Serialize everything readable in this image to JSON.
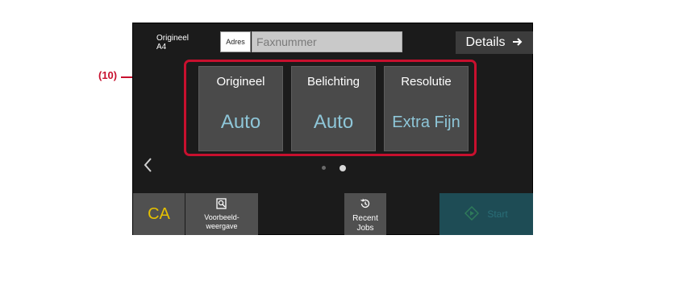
{
  "callout": {
    "label": "(10)",
    "color": "#c8102e"
  },
  "header": {
    "original_label": "Origineel",
    "original_size": "A4",
    "adres_label": "Adres",
    "fax_placeholder": "Faxnummer",
    "details_label": "Details"
  },
  "tiles": [
    {
      "title": "Origineel",
      "value": "Auto"
    },
    {
      "title": "Belichting",
      "value": "Auto"
    },
    {
      "title": "Resolutie",
      "value": "Extra Fijn"
    }
  ],
  "pager": {
    "pages": 2,
    "current": 2
  },
  "bottom_bar": {
    "ca_label": "CA",
    "preview_label_line1": "Voorbeeld-",
    "preview_label_line2": "weergave",
    "recent_label_line1": "Recent",
    "recent_label_line2": "Jobs",
    "start_label": "Start"
  },
  "icons": {
    "details": "arrow-right-icon",
    "prev": "chevron-left-icon",
    "preview": "magnify-page-icon",
    "recent": "history-clock-icon",
    "start": "start-diamond-icon"
  },
  "colors": {
    "accent_value": "#8ec6d8",
    "ca": "#e5c000",
    "start_bg": "#1e4c55",
    "highlight": "#c8102e"
  }
}
